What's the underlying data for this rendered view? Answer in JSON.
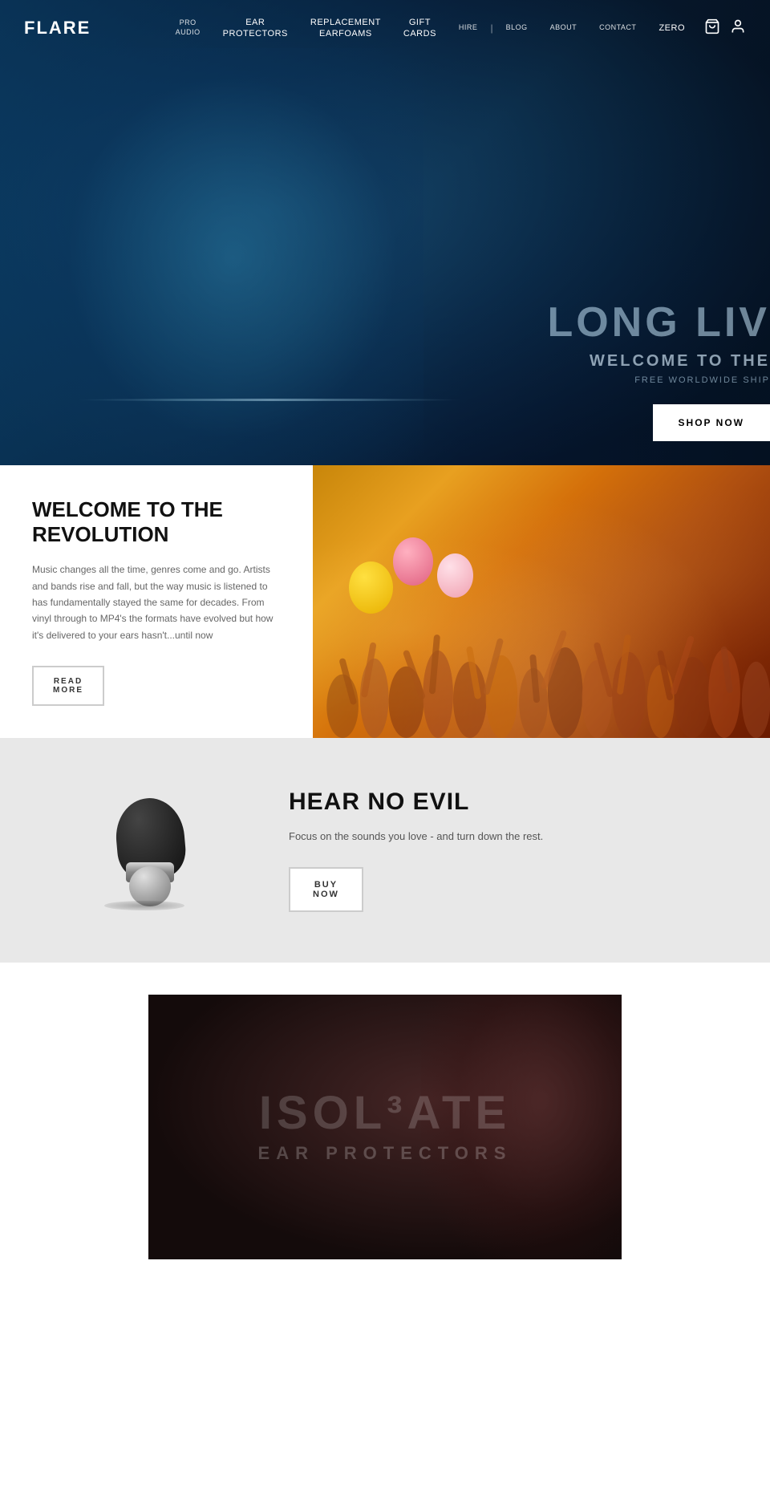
{
  "brand": {
    "logo": "FLARE"
  },
  "nav": {
    "items": [
      {
        "id": "pro-audio",
        "label": "Pro Audio",
        "small": true
      },
      {
        "id": "ear-protectors",
        "label": "Ear\nProtectors",
        "small": false
      },
      {
        "id": "replacement-earfoams",
        "label": "Replacement\nEarfoams",
        "small": false
      },
      {
        "id": "gift-cards",
        "label": "Gift\nCards",
        "small": false
      },
      {
        "id": "hire",
        "label": "Hire",
        "small": true
      },
      {
        "id": "blog",
        "label": "Blog",
        "small": true
      },
      {
        "id": "about",
        "label": "About",
        "small": true
      },
      {
        "id": "contact",
        "label": "Contact",
        "small": true
      },
      {
        "id": "zero",
        "label": "Zero",
        "small": false
      }
    ],
    "cart_icon": "🛒",
    "user_icon": "👤"
  },
  "hero": {
    "headline": "LONG LIV",
    "subheadline": "WELCOME TO THE",
    "shipping": "FREE WORLDWIDE SHIP",
    "cta_label": "SHOP NOW"
  },
  "revolution": {
    "title": "WELCOME TO THE\nREVOLUTION",
    "body": "Music changes all the time, genres come and go. Artists and bands rise and fall, but the way music is listened to has fundamentally stayed the same for decades. From vinyl through to MP4's the formats have evolved but how it's delivered to your ears hasn't...until now",
    "cta_label": "READ\nMORE"
  },
  "hear_no_evil": {
    "title": "HEAR NO EVIL",
    "body": "Focus on the sounds you love - and turn down the rest.",
    "cta_label": "BUY\nNOW"
  },
  "isolate": {
    "title": "ISOL³ATE",
    "subtitle": "EAR PROTECTORS"
  }
}
